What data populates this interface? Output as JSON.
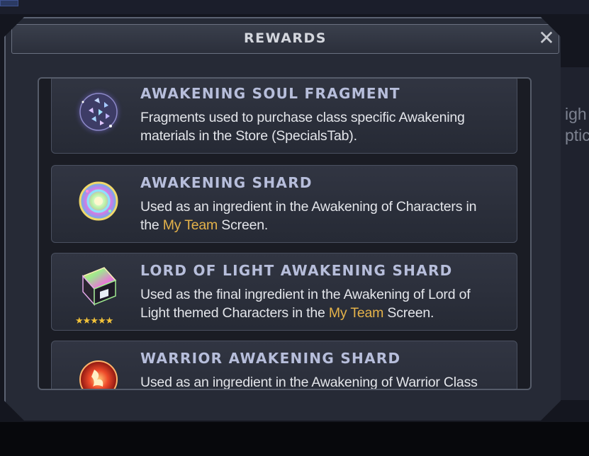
{
  "modal": {
    "title": "REWARDS",
    "close_icon": "close-icon"
  },
  "background": {
    "line1": "igh",
    "line2": "ptic"
  },
  "rewards": [
    {
      "title": "AWAKENING SOUL FRAGMENT",
      "desc_parts": [
        "Fragments used to purchase class specific Awakening materials in the Store (SpecialsTab).",
        "",
        ""
      ],
      "icon": "soul-fragment-icon"
    },
    {
      "title": "AWAKENING SHARD",
      "desc_parts": [
        "Used as an ingredient in the Awakening of Characters in the ",
        "My Team",
        " Screen."
      ],
      "icon": "awakening-shard-icon"
    },
    {
      "title": "LORD OF LIGHT AWAKENING SHARD",
      "desc_parts": [
        "Used as the final ingredient in the Awakening of Lord of Light themed Characters in the ",
        "My Team",
        " Screen."
      ],
      "icon": "lord-of-light-shard-icon",
      "stars": "★★★★★"
    },
    {
      "title": "WARRIOR AWAKENING SHARD",
      "desc_parts": [
        "Used as an ingredient in the Awakening of Warrior Class",
        "",
        ""
      ],
      "icon": "warrior-shard-icon"
    }
  ],
  "colors": {
    "highlight": "#e4b24a",
    "title": "#b7bedb",
    "star": "#f2c23a"
  }
}
